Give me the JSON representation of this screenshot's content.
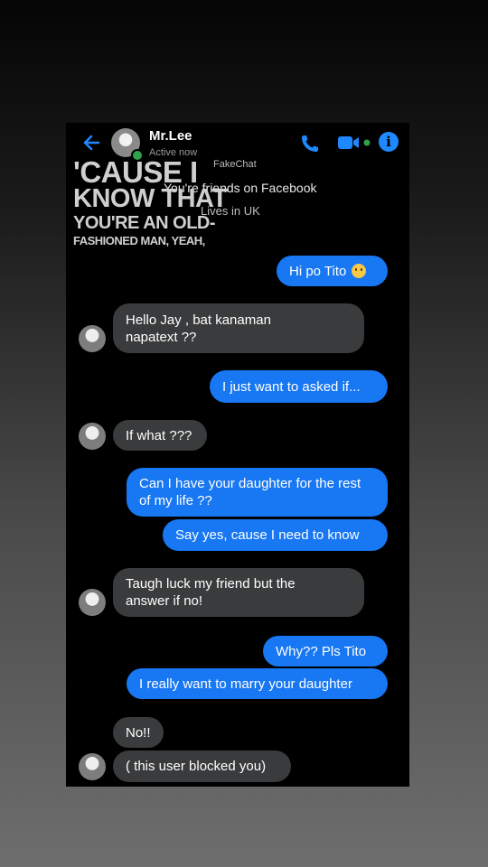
{
  "header": {
    "contact_name": "Mr.Lee",
    "status": "Active now"
  },
  "intro": {
    "name": "FakeChat",
    "friends": "You're friends on Facebook",
    "lives": "Lives in UK"
  },
  "lyrics": {
    "line1": "'CAUSE I",
    "line2": "KNOW THAT",
    "line3": "YOU'RE AN OLD-",
    "line4": "FASHIONED MAN, YEAH,"
  },
  "messages": [
    {
      "from": "me",
      "text": "Hi po Tito"
    },
    {
      "from": "them",
      "text": "Hello Jay , bat kanaman napatext ??"
    },
    {
      "from": "me",
      "text": "I just want to asked if..."
    },
    {
      "from": "them",
      "text": "If what ???"
    },
    {
      "from": "me",
      "text": "Can I have your daughter for the rest of my life ??"
    },
    {
      "from": "me",
      "text": "Say yes, cause I need to know"
    },
    {
      "from": "them",
      "text": "Taugh luck my friend but the answer if no!"
    },
    {
      "from": "me",
      "text": "Why?? Pls Tito"
    },
    {
      "from": "me",
      "text": "I really want to marry your daughter"
    },
    {
      "from": "them",
      "text": "No!!"
    },
    {
      "from": "them",
      "text": "( this user blocked you)"
    }
  ],
  "colors": {
    "accent": "#1877f2",
    "incoming_bubble": "#3a3b3c",
    "active_dot": "#31a24c"
  },
  "icons": [
    "back-arrow-icon",
    "phone-call-icon",
    "video-call-icon",
    "info-icon",
    "smiling-emoji-icon"
  ]
}
